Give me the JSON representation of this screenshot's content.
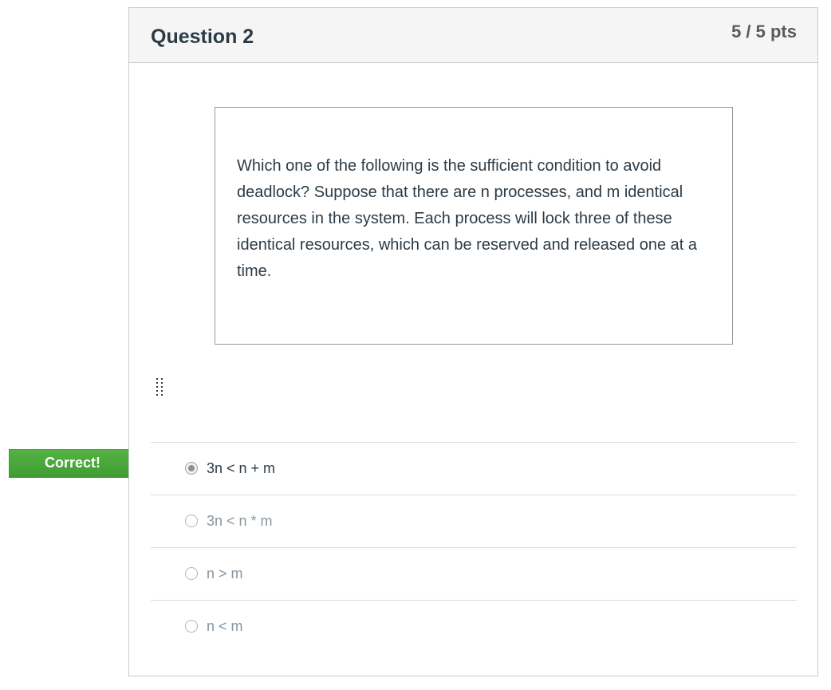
{
  "question": {
    "title": "Question 2",
    "points": "5 / 5 pts",
    "text": "Which one of the following is the sufficient condition to avoid deadlock? Suppose that there are n processes, and m identical resources in the system. Each process will lock three of these identical resources, which can be reserved and released one at a time."
  },
  "feedback": {
    "label": "Correct!",
    "color": "#48a738"
  },
  "answers": [
    {
      "label": "3n < n + m",
      "selected": true
    },
    {
      "label": "3n < n * m",
      "selected": false
    },
    {
      "label": "n > m",
      "selected": false
    },
    {
      "label": "n < m",
      "selected": false
    }
  ],
  "icons": {
    "drag_handle": "drag-handle-icon",
    "radio": "radio-button-icon"
  }
}
